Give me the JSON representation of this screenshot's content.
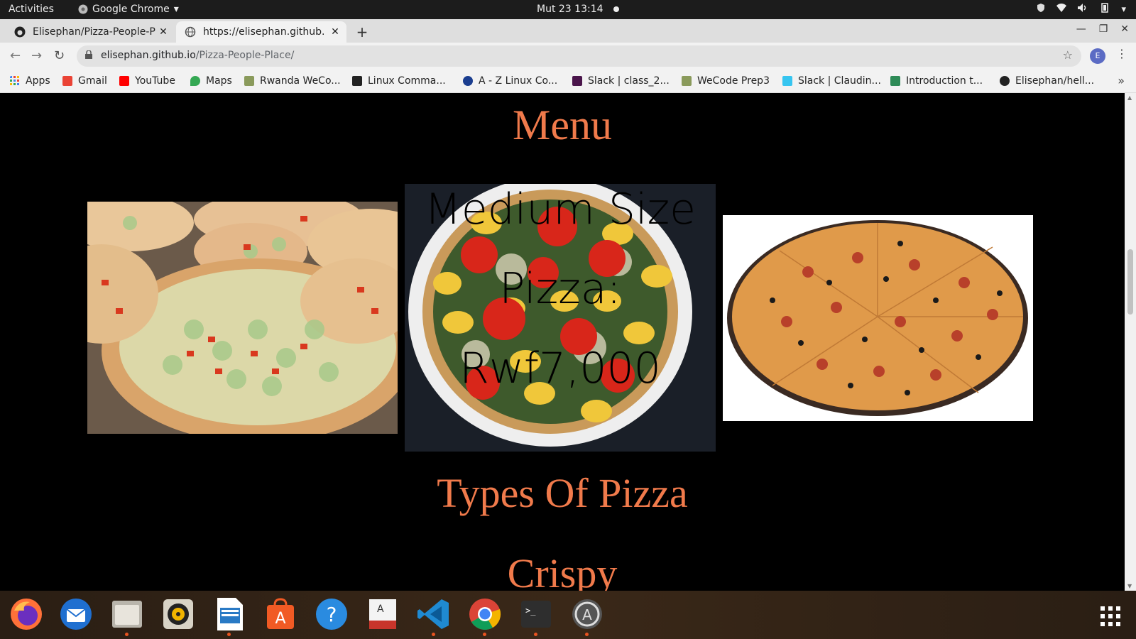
{
  "topbar": {
    "activities": "Activities",
    "app_name": "Google Chrome",
    "clock": "Mut 23  13:14"
  },
  "tabs": [
    {
      "title": "Elisephan/Pizza-People-P",
      "icon": "github-icon"
    },
    {
      "title": "https://elisephan.github.",
      "icon": "globe-icon"
    }
  ],
  "omnibox": {
    "domain": "elisephan.github.io",
    "path": "/Pizza-People-Place/"
  },
  "profile_initial": "E",
  "bookmarks": [
    {
      "label": "Apps",
      "color": "#4285f4"
    },
    {
      "label": "Gmail",
      "color": "#ea4335"
    },
    {
      "label": "YouTube",
      "color": "#ff0000"
    },
    {
      "label": "Maps",
      "color": "#34a853"
    },
    {
      "label": "Rwanda WeCo...",
      "color": "#8a9a5b"
    },
    {
      "label": "Linux Comma...",
      "color": "#222222"
    },
    {
      "label": "A - Z Linux Co...",
      "color": "#1a3d8f"
    },
    {
      "label": "Slack | class_2...",
      "color": "#4a154b"
    },
    {
      "label": "WeCode Prep3",
      "color": "#8a9a5b"
    },
    {
      "label": "Slack | Claudin...",
      "color": "#36c5f0"
    },
    {
      "label": "Introduction t...",
      "color": "#2e8b57"
    },
    {
      "label": "Elisephan/hell...",
      "color": "#222222"
    }
  ],
  "page": {
    "menu_title": "Menu",
    "overlay_lines": [
      "Medium Size",
      "Pizza:",
      "Rwf7,000"
    ],
    "types_title": "Types Of Pizza",
    "crispy": "Crispy"
  },
  "dock": [
    {
      "name": "firefox-icon",
      "running": false
    },
    {
      "name": "thunderbird-icon",
      "running": false
    },
    {
      "name": "files-icon",
      "running": true
    },
    {
      "name": "rhythmbox-icon",
      "running": false
    },
    {
      "name": "writer-icon",
      "running": true
    },
    {
      "name": "software-icon",
      "running": false
    },
    {
      "name": "help-icon",
      "running": false
    },
    {
      "name": "document-viewer-icon",
      "running": false
    },
    {
      "name": "vscode-icon",
      "running": true
    },
    {
      "name": "chrome-icon",
      "running": true
    },
    {
      "name": "terminal-icon",
      "running": true
    },
    {
      "name": "updater-icon",
      "running": true
    }
  ]
}
